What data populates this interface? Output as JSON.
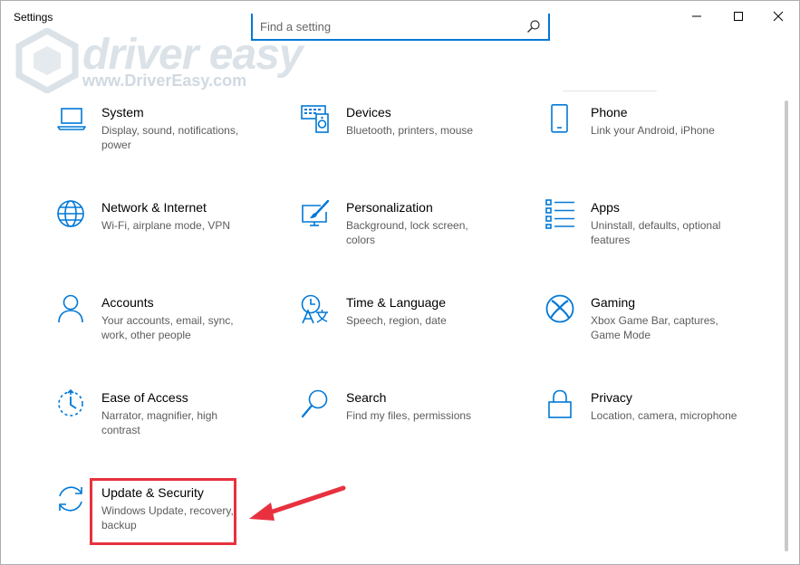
{
  "window": {
    "title": "Settings"
  },
  "search": {
    "placeholder": "Find a setting"
  },
  "watermark": {
    "brand": "driver easy",
    "url": "www.DriverEasy.com"
  },
  "tiles": [
    {
      "title": "System",
      "desc": "Display, sound, notifications, power",
      "icon": "laptop-icon"
    },
    {
      "title": "Devices",
      "desc": "Bluetooth, printers, mouse",
      "icon": "devices-icon"
    },
    {
      "title": "Phone",
      "desc": "Link your Android, iPhone",
      "icon": "phone-icon"
    },
    {
      "title": "Network & Internet",
      "desc": "Wi-Fi, airplane mode, VPN",
      "icon": "globe-icon"
    },
    {
      "title": "Personalization",
      "desc": "Background, lock screen, colors",
      "icon": "paintbrush-icon"
    },
    {
      "title": "Apps",
      "desc": "Uninstall, defaults, optional features",
      "icon": "apps-list-icon"
    },
    {
      "title": "Accounts",
      "desc": "Your accounts, email, sync, work, other people",
      "icon": "person-icon"
    },
    {
      "title": "Time & Language",
      "desc": "Speech, region, date",
      "icon": "time-language-icon"
    },
    {
      "title": "Gaming",
      "desc": "Xbox Game Bar, captures, Game Mode",
      "icon": "xbox-icon"
    },
    {
      "title": "Ease of Access",
      "desc": "Narrator, magnifier, high contrast",
      "icon": "ease-of-access-icon"
    },
    {
      "title": "Search",
      "desc": "Find my files, permissions",
      "icon": "search-icon"
    },
    {
      "title": "Privacy",
      "desc": "Location, camera, microphone",
      "icon": "lock-icon"
    },
    {
      "title": "Update & Security",
      "desc": "Windows Update, recovery, backup",
      "icon": "sync-icon"
    }
  ],
  "colors": {
    "accent": "#0078d7",
    "highlight": "#e8313f",
    "desc_text": "#5c5c5c"
  }
}
